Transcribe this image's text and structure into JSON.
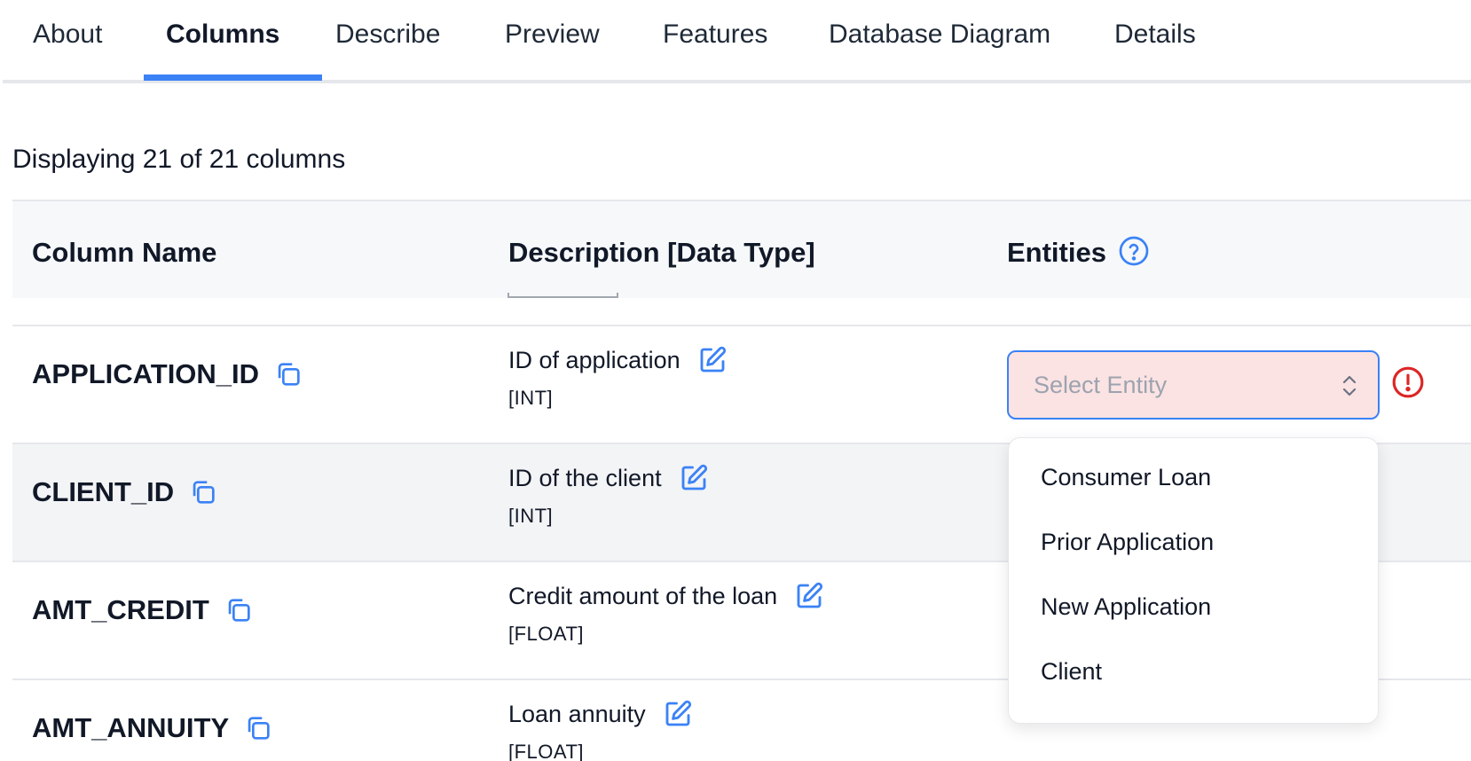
{
  "tabs": [
    {
      "label": "About"
    },
    {
      "label": "Columns"
    },
    {
      "label": "Describe"
    },
    {
      "label": "Preview"
    },
    {
      "label": "Features"
    },
    {
      "label": "Database Diagram"
    },
    {
      "label": "Details"
    }
  ],
  "active_tab": "Columns",
  "summary": "Displaying 21 of 21 columns",
  "table": {
    "headers": [
      "Column Name",
      "Description [Data Type]",
      "Entities"
    ],
    "rows": [
      {
        "name": "APPLICATION_ID",
        "description": "ID of application",
        "type": "[INT]"
      },
      {
        "name": "CLIENT_ID",
        "description": "ID of the client",
        "type": "[INT]"
      },
      {
        "name": "AMT_CREDIT",
        "description": "Credit amount of the loan",
        "type": "[FLOAT]"
      },
      {
        "name": "AMT_ANNUITY",
        "description": "Loan annuity",
        "type": "[FLOAT]"
      }
    ]
  },
  "entity_select": {
    "placeholder": "Select Entity",
    "options": [
      "Consumer Loan",
      "Prior Application",
      "New Application",
      "Client"
    ]
  },
  "colors": {
    "accent": "#3b82f6",
    "error": "#dc2626",
    "select_bg": "#fbe3e3",
    "header_bg": "#f6f8fa"
  },
  "icons": {
    "copy": "copy-icon",
    "edit": "edit-icon",
    "help": "help-circle-icon",
    "error": "alert-circle-icon",
    "chevron": "chevron-up-down-icon"
  }
}
